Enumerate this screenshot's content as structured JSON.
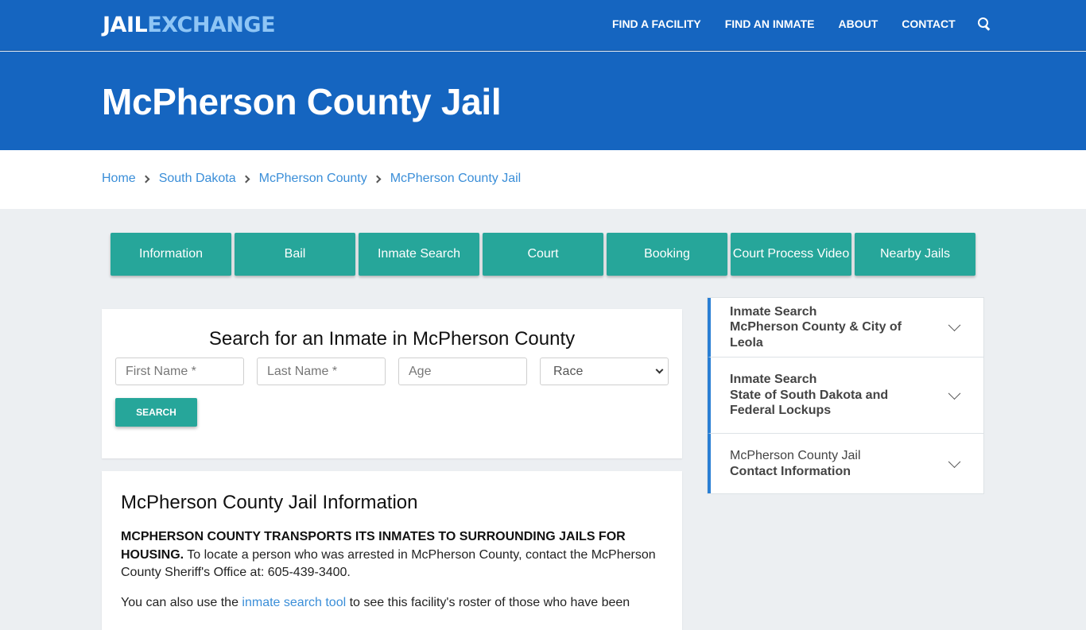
{
  "nav": {
    "logo_part1": "JAIL",
    "logo_part2": "EXCHANGE",
    "links": [
      "FIND A FACILITY",
      "FIND AN INMATE",
      "ABOUT",
      "CONTACT"
    ],
    "search_icon": "search-icon"
  },
  "hero": {
    "title": "McPherson County Jail"
  },
  "breadcrumb": [
    "Home",
    "South Dakota",
    "McPherson County",
    "McPherson County Jail"
  ],
  "tabs": [
    "Information",
    "Bail",
    "Inmate Search",
    "Court",
    "Booking",
    "Court Process Video",
    "Nearby Jails"
  ],
  "search": {
    "title": "Search for an Inmate in McPherson County",
    "first_name_placeholder": "First Name *",
    "last_name_placeholder": "Last Name *",
    "age_placeholder": "Age",
    "race_selected": "Race",
    "button": "SEARCH"
  },
  "info": {
    "title": "McPherson County Jail Information",
    "p1_bold": "MCPHERSON COUNTY TRANSPORTS ITS INMATES TO SURROUNDING JAILS FOR HOUSING.",
    "p1_text": " To locate a person who was arrested in McPherson County, contact the McPherson County Sheriff's Office at: 605-439-3400.",
    "p2_before": "You can also use the ",
    "p2_link": "inmate search tool",
    "p2_after": " to see this facility's roster of those who have been"
  },
  "sidebar": {
    "items": [
      {
        "line1": "Inmate Search",
        "line2": "McPherson County & City of Leola"
      },
      {
        "line1": "Inmate Search",
        "line2": "State of South Dakota and Federal Lockups"
      },
      {
        "line1": "McPherson County Jail",
        "line2": "Contact Information"
      }
    ]
  }
}
